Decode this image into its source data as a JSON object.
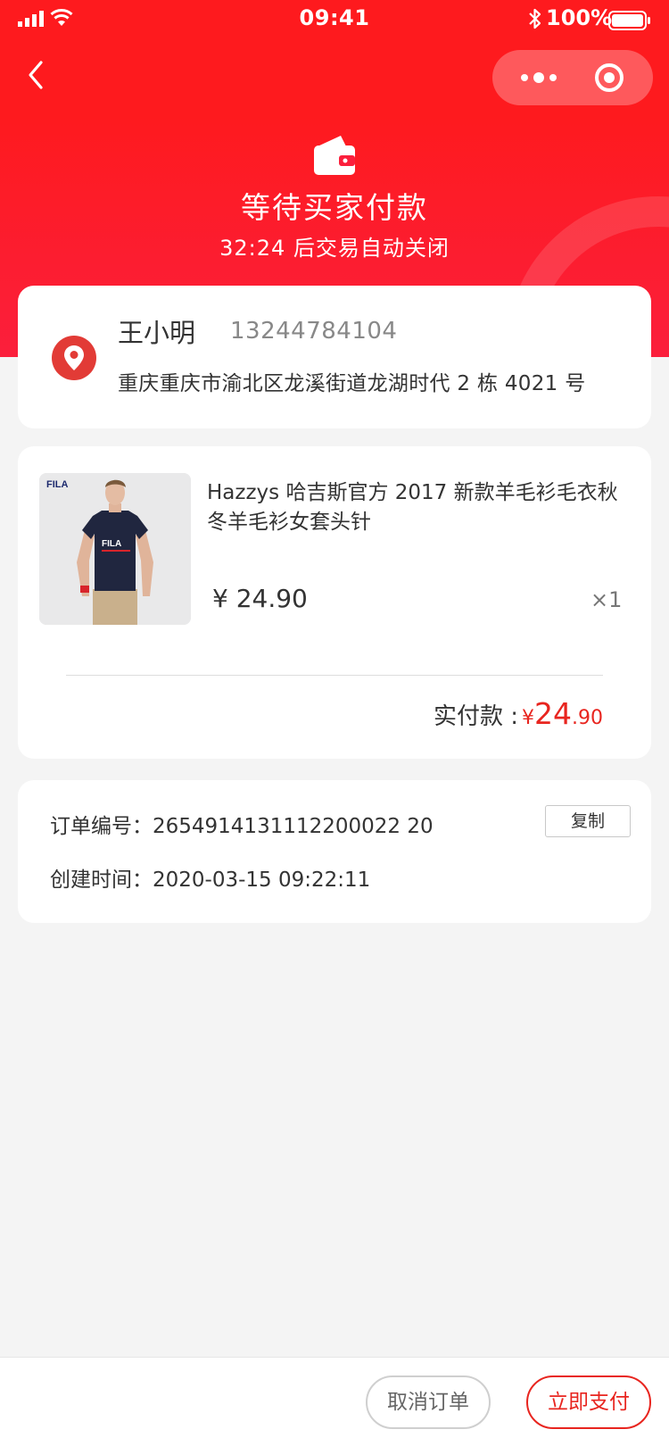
{
  "status_bar": {
    "time": "09:41",
    "battery": "100%"
  },
  "header": {
    "title": "等待买家付款",
    "subtitle": "32:24 后交易自动关闭"
  },
  "address": {
    "name": "王小明",
    "phone": "13244784104",
    "detail": "重庆重庆市渝北区龙溪街道龙湖时代 2 栋 4021 号"
  },
  "product": {
    "image_brand": "FILA",
    "title": "Hazzys 哈吉斯官方 2017 新款羊毛衫毛衣秋冬羊毛衫女套头针",
    "price": "¥ 24.90",
    "quantity": "×1"
  },
  "payment": {
    "label": "实付款 :",
    "currency": "¥",
    "amount_int": "24",
    "amount_dec": ".90"
  },
  "order": {
    "number_line": "订单编号：2654914131112200022 20",
    "time_line": "创建时间：2020-03-15 09:22:11",
    "copy_label": "复制"
  },
  "actions": {
    "cancel_label": "取消订单",
    "pay_label": "立即支付"
  },
  "colors": {
    "brand_red": "#fe1a1e",
    "price_red": "#e8251f",
    "background": "#f4f4f4"
  }
}
